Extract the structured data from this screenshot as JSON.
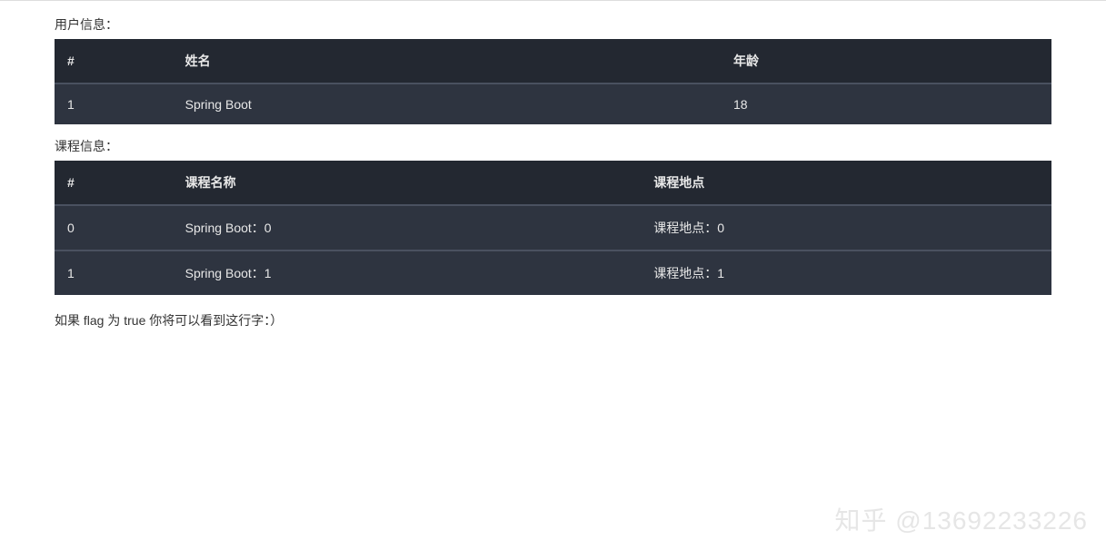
{
  "userSection": {
    "title": "用户信息：",
    "headers": {
      "idx": "#",
      "name": "姓名",
      "age": "年龄"
    },
    "rows": [
      {
        "idx": "1",
        "name": "Spring Boot",
        "age": "18"
      }
    ]
  },
  "courseSection": {
    "title": "课程信息：",
    "headers": {
      "idx": "#",
      "cname": "课程名称",
      "cloc": "课程地点"
    },
    "rows": [
      {
        "idx": "0",
        "cname": "Spring Boot：0",
        "cloc": "课程地点：0"
      },
      {
        "idx": "1",
        "cname": "Spring Boot：1",
        "cloc": "课程地点：1"
      }
    ]
  },
  "flagText": "如果 flag 为 true 你将可以看到这行字：）",
  "watermark": "知乎 @13692233226"
}
